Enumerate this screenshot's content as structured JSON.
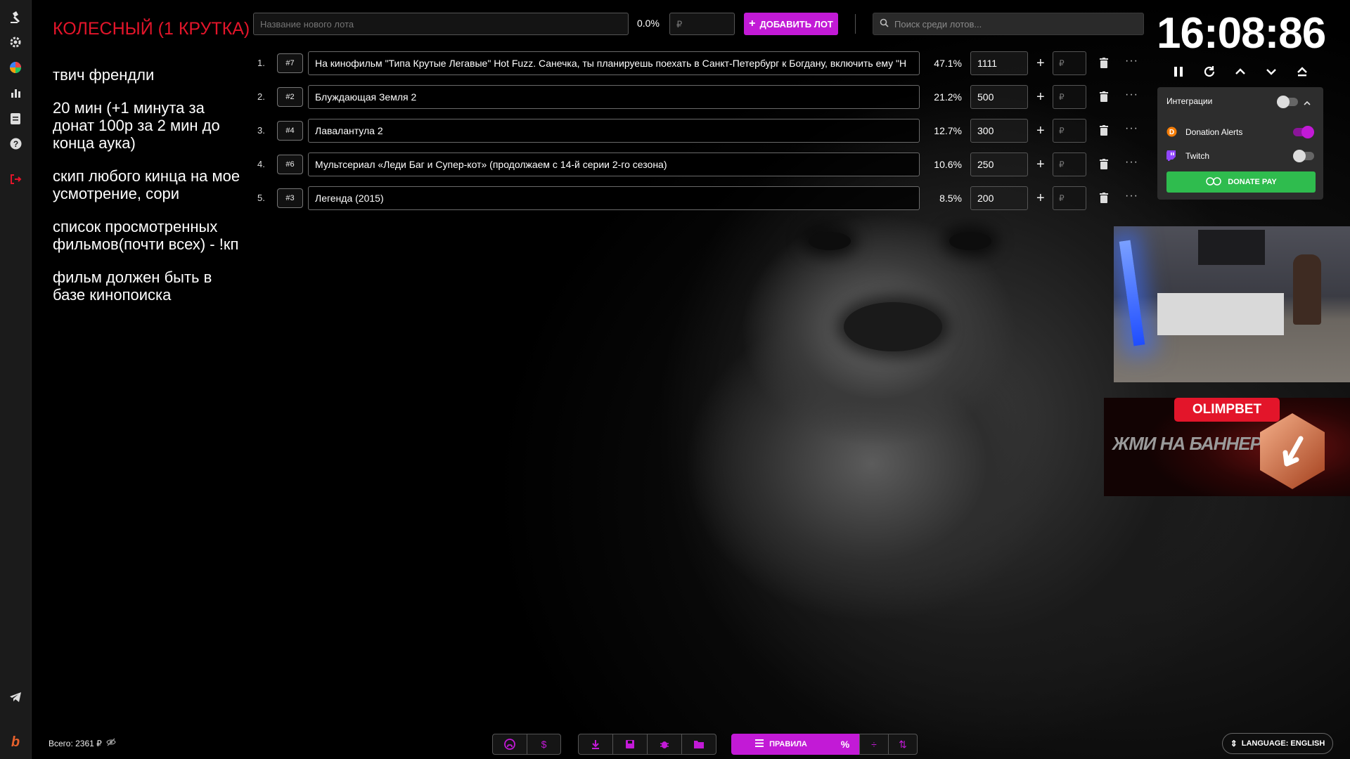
{
  "sidebar": {
    "icons": [
      "gavel-icon",
      "settings-icon",
      "pie-chart-icon",
      "bar-chart-icon",
      "clipboard-icon",
      "help-icon",
      "logout-icon",
      "telegram-icon",
      "brand-logo-icon"
    ]
  },
  "left": {
    "title": "КОЛЕСНЫЙ (1 КРУТКА)",
    "notes": [
      "твич френдли",
      "20 мин (+1 минута за донат 100р за 2 мин до конца аука)",
      "скип любого кинца на мое усмотрение, сори",
      "список просмотренных фильмов(почти всех) - !кп",
      "фильм должен быть в базе кинопоиска"
    ],
    "total": "Всего: 2361 ₽"
  },
  "topbar": {
    "new_lot_placeholder": "Название нового лота",
    "new_lot_pct": "0.0%",
    "new_lot_amount_placeholder": "₽",
    "add_lot_label": "ДОБАВИТЬ ЛОТ",
    "search_placeholder": "Поиск среди лотов..."
  },
  "lots": [
    {
      "num": "1.",
      "id": "#7",
      "name": "На кинофильм \"Типа Крутые Легавые\" Hot Fuzz. Санечка, ты планируешь поехать в Санкт-Петербург к Богдану, включить ему \"Н",
      "pct": "47.1%",
      "amount": "1111",
      "currency": "₽"
    },
    {
      "num": "2.",
      "id": "#2",
      "name": "Блуждающая Земля 2",
      "pct": "21.2%",
      "amount": "500",
      "currency": "₽"
    },
    {
      "num": "3.",
      "id": "#4",
      "name": "Лавалантула 2",
      "pct": "12.7%",
      "amount": "300",
      "currency": "₽"
    },
    {
      "num": "4.",
      "id": "#6",
      "name": "Мультсериал «Леди Баг и Супер-кот» (продолжаем с 14-й серии 2-го сезона)",
      "pct": "10.6%",
      "amount": "250",
      "currency": "₽"
    },
    {
      "num": "5.",
      "id": "#3",
      "name": "Легенда (2015)",
      "pct": "8.5%",
      "amount": "200",
      "currency": "₽"
    }
  ],
  "timer": {
    "value": "16:08:86"
  },
  "integrations": {
    "header": "Интеграции",
    "enabled": false,
    "items": [
      {
        "label": "Donation Alerts",
        "enabled": true,
        "color": "#c21ad6"
      },
      {
        "label": "Twitch",
        "enabled": false,
        "color": "#9146ff"
      }
    ],
    "donate_pay_label": "DONATE PAY"
  },
  "ad": {
    "brand": "OLIMPBET",
    "cta": "ЖМИ НА БАННЕР"
  },
  "bottom": {
    "rules_label": "ПРАВИЛА",
    "language_label": "LANGUAGE: ENGLISH"
  },
  "colors": {
    "accent": "#c21ad6",
    "title_red": "#e3152a",
    "donate_green": "#2fbc4e"
  }
}
